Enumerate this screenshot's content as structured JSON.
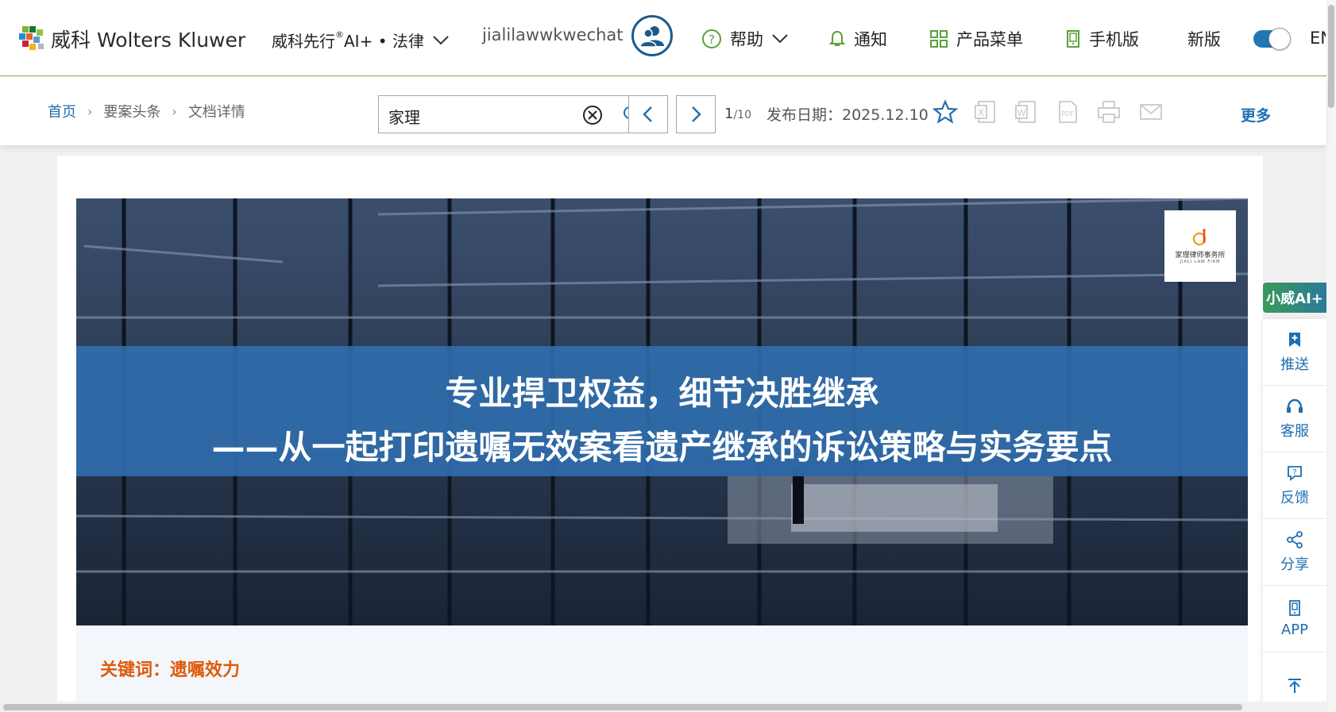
{
  "header": {
    "brand": "威科 Wolters Kluwer",
    "product_prefix": "威科先行",
    "product_reg": "®",
    "product_suffix": "AI+ • 法律",
    "username": "jialilawwkwechat",
    "help_label": "帮助",
    "notify_label": "通知",
    "product_menu_label": "产品菜单",
    "mobile_label": "手机版",
    "new_version_label": "新版",
    "new_version_on": true,
    "lang_label": "EN"
  },
  "toolbar": {
    "breadcrumb": [
      "首页",
      "要案头条",
      "文档详情"
    ],
    "search_value": "家理",
    "page_current": "1",
    "page_total": "/10",
    "pub_date": "发布日期：2025.12.10",
    "more_label": "更多"
  },
  "article": {
    "title_line1": "专业捍卫权益，细节决胜继承",
    "title_line2": "——从一起打印遗嘱无效案看遗产继承的诉讼策略与实务要点",
    "firm_name": "家理律师事务所",
    "firm_name_en": "JIALI LAW FIRM",
    "keywords": "关键词：遗嘱效力"
  },
  "side_panel": {
    "ai_label": "小威AI+",
    "items": [
      {
        "label": "推送",
        "icon": "bookmark-plus-icon"
      },
      {
        "label": "客服",
        "icon": "headset-icon"
      },
      {
        "label": "反馈",
        "icon": "feedback-icon"
      },
      {
        "label": "分享",
        "icon": "share-icon"
      },
      {
        "label": "APP",
        "icon": "phone-icon"
      }
    ]
  },
  "colors": {
    "accent": "#1f6fb2",
    "header_rule": "#86b468",
    "keyword": "#e05a0c",
    "title_band": "#3070b0"
  }
}
